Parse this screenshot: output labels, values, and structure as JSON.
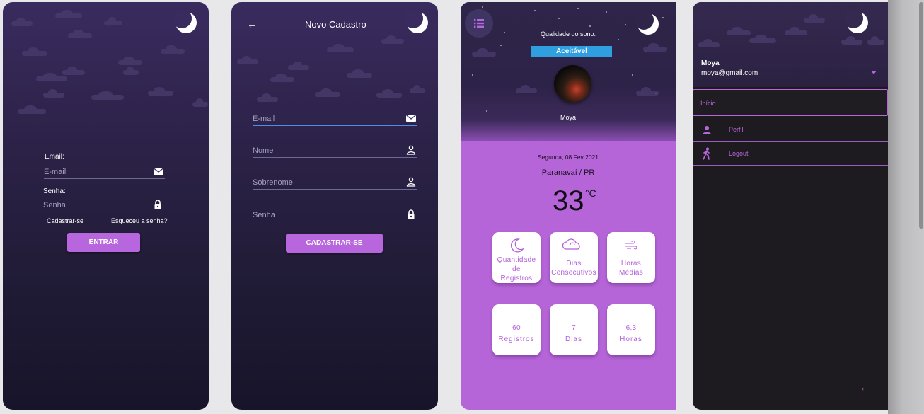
{
  "login": {
    "email_label": "Email:",
    "email_placeholder": "E-mail",
    "password_label": "Senha:",
    "password_placeholder": "Senha",
    "signup_link": "Cadastrar-se",
    "forgot_link": "Esqueceu a senha?",
    "submit_label": "ENTRAR"
  },
  "register": {
    "title": "Novo Cadastro",
    "email_placeholder": "E-mail",
    "name_placeholder": "Nome",
    "surname_placeholder": "Sobrenome",
    "password_placeholder": "Senha",
    "submit_label": "CADASTRAR-SE"
  },
  "dashboard": {
    "quality_label": "Qualidade do sono:",
    "quality_value": "Aceitável",
    "user_name": "Moya",
    "date": "Segunda, 08 Fev 2021",
    "location": "Paranavaí / PR",
    "temperature": "33",
    "temperature_unit": "°C",
    "cards": [
      {
        "lines": [
          "Quantidade",
          "de",
          "Registros"
        ],
        "icon": "moon-icon"
      },
      {
        "lines": [
          "Dias",
          "Consecutivos"
        ],
        "icon": "cloud-icon"
      },
      {
        "lines": [
          "Horas",
          "Médias"
        ],
        "icon": "wind-icon"
      }
    ],
    "stats": [
      {
        "value": "60",
        "unit": "Registros"
      },
      {
        "value": "7",
        "unit": "Dias"
      },
      {
        "value": "6,3",
        "unit": "Horas"
      }
    ]
  },
  "drawer": {
    "user_name": "Moya",
    "user_email": "moya@gmail.com",
    "items": [
      {
        "label": "Início",
        "icon": "",
        "active": true
      },
      {
        "label": "Perfil",
        "icon": "person-icon",
        "active": false
      },
      {
        "label": "Logout",
        "icon": "walk-icon",
        "active": false
      }
    ]
  },
  "colors": {
    "accent": "#b866dd",
    "quality_badge": "#2f9fe0",
    "dashboard_bg": "#b565d8",
    "drawer_bg": "#1d1b1f"
  }
}
